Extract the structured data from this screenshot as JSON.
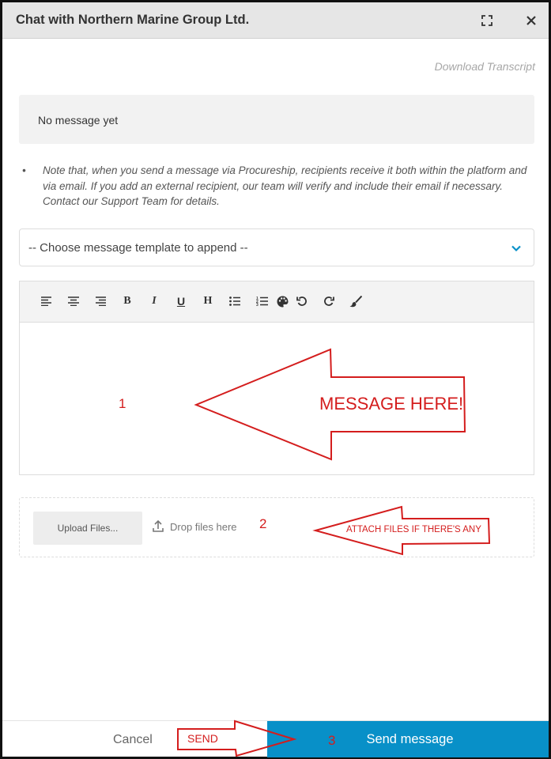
{
  "header": {
    "title": "Chat with Northern Marine Group Ltd."
  },
  "transcript_link": "Download Transcript",
  "messages": {
    "empty_text": "No message yet"
  },
  "note": {
    "bullet": "•",
    "text": "Note that, when you send a message via Procureship, recipients receive it both within the platform and via email. If you add an external recipient, our team will verify and include their email if necessary. Contact our Support Team for details."
  },
  "template_select": {
    "value": "-- Choose message template to append --"
  },
  "toolbar": {
    "bold": "B",
    "italic": "I",
    "underline": "U",
    "heading": "H"
  },
  "upload": {
    "button_label": "Upload Files...",
    "drop_label": "Drop files here"
  },
  "footer": {
    "cancel_label": "Cancel",
    "send_label": "Send message"
  },
  "annotations": {
    "step1_number": "1",
    "step1_text": "MESSAGE HERE!",
    "step2_number": "2",
    "step2_text": "ATTACH FILES IF THERE'S ANY",
    "step3_number": "3",
    "step3_text": "SEND"
  },
  "colors": {
    "accent": "#0890c8",
    "annotation": "#d41d1d",
    "header_bg": "#e6e6e6"
  }
}
